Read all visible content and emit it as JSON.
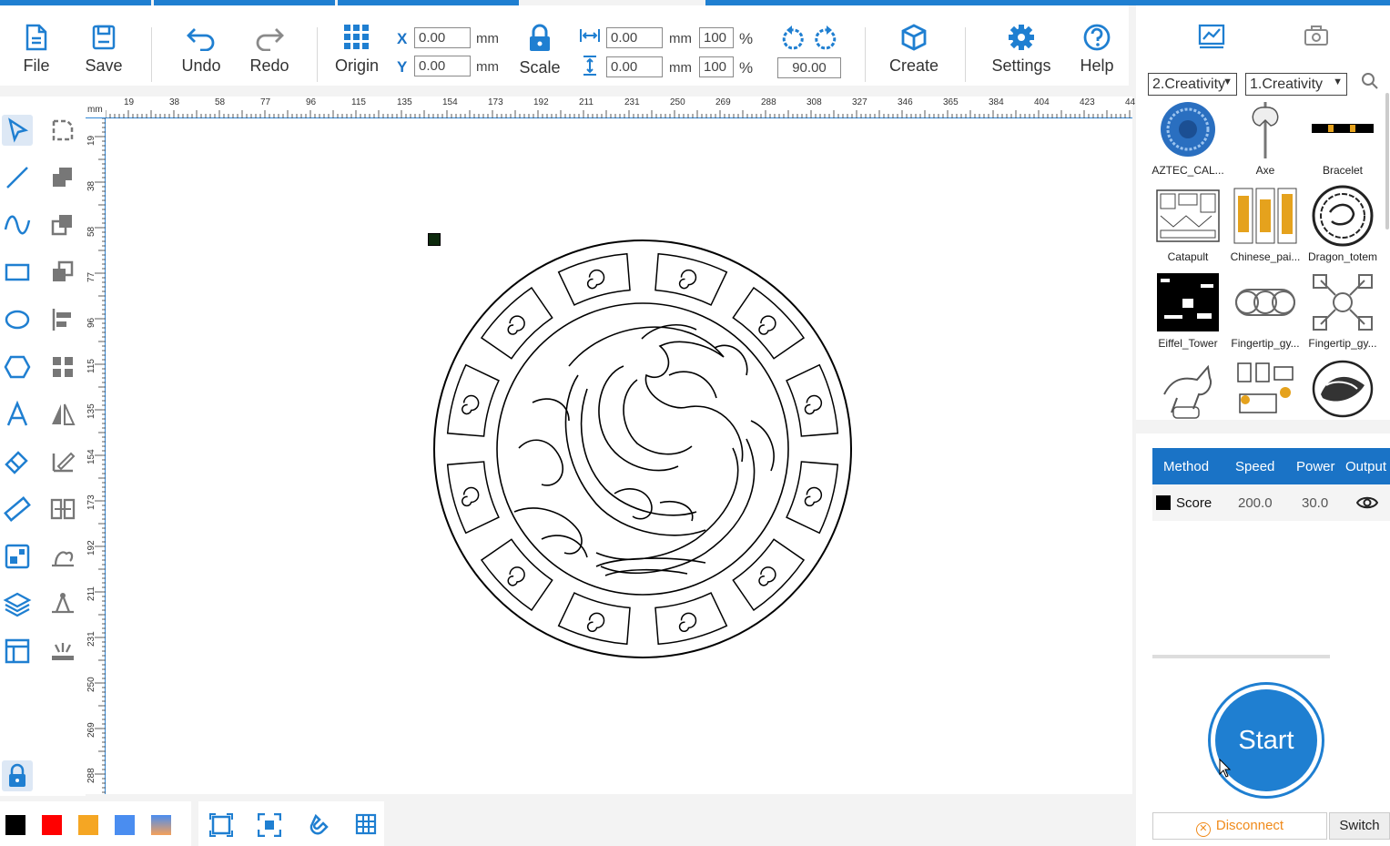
{
  "toolbar": {
    "file_label": "File",
    "save_label": "Save",
    "undo_label": "Undo",
    "redo_label": "Redo",
    "origin_label": "Origin",
    "scale_label": "Scale",
    "create_label": "Create",
    "settings_label": "Settings",
    "help_label": "Help"
  },
  "position": {
    "x_label": "X",
    "x_value": "0.00",
    "x_unit": "mm",
    "y_label": "Y",
    "y_value": "0.00",
    "y_unit": "mm"
  },
  "size": {
    "width_value": "0.00",
    "width_unit": "mm",
    "width_pct": "100",
    "width_pct_sign": "%",
    "height_value": "0.00",
    "height_unit": "mm",
    "height_pct": "100",
    "height_pct_sign": "%"
  },
  "rotation": {
    "value": "90.00"
  },
  "ruler": {
    "unit": "mm",
    "h_ticks": [
      "19",
      "38",
      "58",
      "77",
      "96",
      "115",
      "135",
      "154",
      "173",
      "192",
      "211",
      "231",
      "250",
      "269",
      "288",
      "308",
      "327",
      "346",
      "365",
      "384",
      "404",
      "423",
      "44"
    ],
    "v_ticks": [
      "19",
      "38",
      "58",
      "77",
      "96",
      "115",
      "135",
      "154",
      "173",
      "192",
      "211",
      "231",
      "250",
      "269",
      "288"
    ]
  },
  "library": {
    "category1": "2.Creativity",
    "category2": "1.Creativity",
    "items": [
      {
        "name": "AZTEC_CAL..."
      },
      {
        "name": "Axe"
      },
      {
        "name": "Bracelet"
      },
      {
        "name": "Catapult"
      },
      {
        "name": "Chinese_pai..."
      },
      {
        "name": "Dragon_totem"
      },
      {
        "name": "Eiffel_Tower"
      },
      {
        "name": "Fingertip_gy..."
      },
      {
        "name": "Fingertip_gy..."
      },
      {
        "name": ""
      },
      {
        "name": ""
      },
      {
        "name": ""
      }
    ]
  },
  "layers": {
    "headers": [
      "Method",
      "Speed",
      "Power",
      "Output"
    ],
    "rows": [
      {
        "color": "#000000",
        "method": "Score",
        "speed": "200.0",
        "power": "30.0"
      }
    ]
  },
  "actions": {
    "start_label": "Start",
    "disconnect_label": "Disconnect",
    "switch_label": "Switch"
  },
  "palette": [
    "#000000",
    "#ff0000",
    "#f5a623",
    "#4a8df0",
    "gradient"
  ],
  "colors": {
    "accent": "#1f7fd1",
    "warning": "#f08a1a"
  }
}
